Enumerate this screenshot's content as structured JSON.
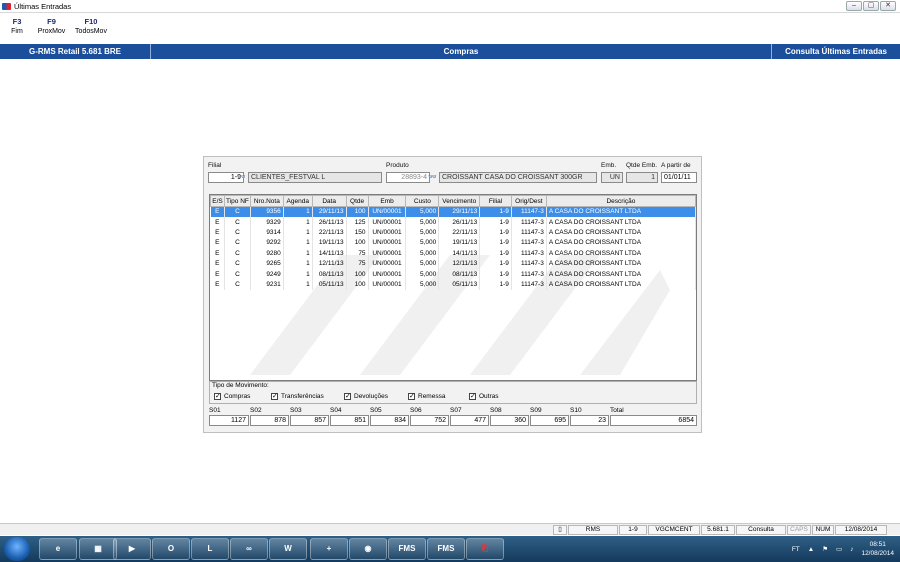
{
  "window": {
    "title": "Últimas Entradas"
  },
  "toolbar": [
    {
      "key": "F3",
      "label": "Fim"
    },
    {
      "key": "F9",
      "label": "ProxMov"
    },
    {
      "key": "F10",
      "label": "TodosMov"
    }
  ],
  "banner": {
    "left": "G-RMS Retail 5.681 BRE",
    "center": "Compras",
    "right": "Consulta Últimas Entradas"
  },
  "header": {
    "filial_label": "Filial",
    "filial_code": "1-9",
    "filial_name": "CLIENTES_FESTVAL L",
    "produto_label": "Produto",
    "produto_code": "28893-4",
    "produto_name": "CROISSANT CASA DO CROISSANT 300GR",
    "emb_label": "Emb.",
    "emb_value": "UN",
    "qtde_emb_label": "Qtde Emb.",
    "qtde_emb_value": "1",
    "apartir_label": "A partir de",
    "apartir_value": "01/01/11"
  },
  "grid": {
    "columns": [
      "E/S",
      "Tipo NF",
      "Nro.Nota",
      "Agenda",
      "Data",
      "Qtde",
      "Emb",
      "Custo",
      "Vencimento",
      "Filial",
      "Orig/Dest",
      "Descrição"
    ],
    "rows": [
      [
        "E",
        "C",
        "9356",
        "1",
        "29/11/13",
        "100",
        "UN/00001",
        "5,000",
        "29/11/13",
        "1-9",
        "11147-3",
        "A CASA DO CROISSANT LTDA"
      ],
      [
        "E",
        "C",
        "9329",
        "1",
        "26/11/13",
        "125",
        "UN/00001",
        "5,000",
        "26/11/13",
        "1-9",
        "11147-3",
        "A CASA DO CROISSANT LTDA"
      ],
      [
        "E",
        "C",
        "9314",
        "1",
        "22/11/13",
        "150",
        "UN/00001",
        "5,000",
        "22/11/13",
        "1-9",
        "11147-3",
        "A CASA DO CROISSANT LTDA"
      ],
      [
        "E",
        "C",
        "9292",
        "1",
        "19/11/13",
        "100",
        "UN/00001",
        "5,000",
        "19/11/13",
        "1-9",
        "11147-3",
        "A CASA DO CROISSANT LTDA"
      ],
      [
        "E",
        "C",
        "9280",
        "1",
        "14/11/13",
        "75",
        "UN/00001",
        "5,000",
        "14/11/13",
        "1-9",
        "11147-3",
        "A CASA DO CROISSANT LTDA"
      ],
      [
        "E",
        "C",
        "9265",
        "1",
        "12/11/13",
        "75",
        "UN/00001",
        "5,000",
        "12/11/13",
        "1-9",
        "11147-3",
        "A CASA DO CROISSANT LTDA"
      ],
      [
        "E",
        "C",
        "9249",
        "1",
        "08/11/13",
        "100",
        "UN/00001",
        "5,000",
        "08/11/13",
        "1-9",
        "11147-3",
        "A CASA DO CROISSANT LTDA"
      ],
      [
        "E",
        "C",
        "9231",
        "1",
        "05/11/13",
        "100",
        "UN/00001",
        "5,000",
        "05/11/13",
        "1-9",
        "11147-3",
        "A CASA DO CROISSANT LTDA"
      ]
    ]
  },
  "tipo_movimento": {
    "title": "Tipo de Movimento:",
    "options": [
      {
        "label": "Compras",
        "checked": true
      },
      {
        "label": "Transferências",
        "checked": true
      },
      {
        "label": "Devoluções",
        "checked": true
      },
      {
        "label": "Remessa",
        "checked": true
      },
      {
        "label": "Outras",
        "checked": true
      }
    ]
  },
  "totals": [
    {
      "label": "S01",
      "value": "1127"
    },
    {
      "label": "S02",
      "value": "878"
    },
    {
      "label": "S03",
      "value": "857"
    },
    {
      "label": "S04",
      "value": "851"
    },
    {
      "label": "S05",
      "value": "834"
    },
    {
      "label": "S06",
      "value": "752"
    },
    {
      "label": "S07",
      "value": "477"
    },
    {
      "label": "S08",
      "value": "360"
    },
    {
      "label": "S09",
      "value": "695"
    },
    {
      "label": "S10",
      "value": "23"
    },
    {
      "label": "Total",
      "value": "6854"
    }
  ],
  "statusbar": [
    "RMS",
    "1-9",
    "VGCMCENT",
    "5.681.1",
    "Consulta",
    "CAPS",
    "NUM",
    "12/08/2014"
  ],
  "taskbar": {
    "apps": [
      "FMS",
      "FMS"
    ],
    "tray_lang": "FT",
    "time": "08:51",
    "date": "12/08/2014"
  },
  "colors": {
    "banner": "#1b4f9c",
    "selection": "#3d8ee8"
  }
}
